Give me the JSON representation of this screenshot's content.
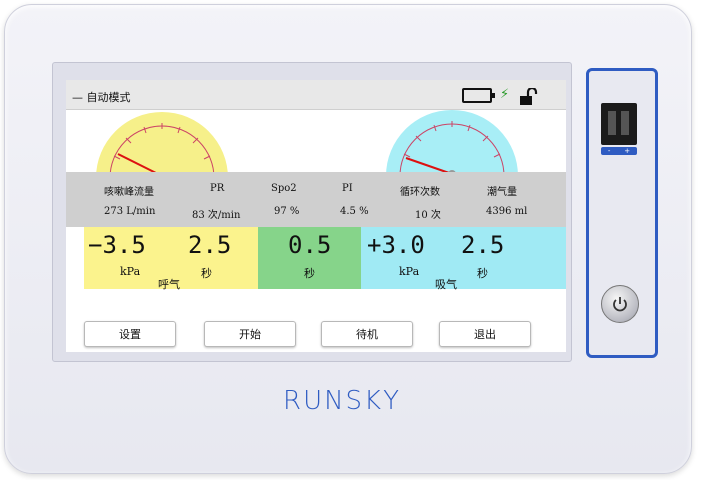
{
  "status_bar": {
    "mode_title": "— 自动模式",
    "icons": [
      "battery-icon",
      "plug-icon",
      "unlock-icon"
    ]
  },
  "parameters": [
    {
      "name": "咳嗽峰流量",
      "value": "273 L/min"
    },
    {
      "name": "PR",
      "value": "83 次/min"
    },
    {
      "name": "Spo2",
      "value": "97 %"
    },
    {
      "name": "PI",
      "value": "4.5 %"
    },
    {
      "name": "循环次数",
      "value": "10 次"
    },
    {
      "name": "潮气量",
      "value": "4396 ml"
    }
  ],
  "readouts": {
    "exhale": {
      "pressure": "−3.5",
      "pressure_unit": "kPa",
      "time": "2.5",
      "time_unit": "秒",
      "phase": "呼气"
    },
    "pause": {
      "time": "0.5",
      "time_unit": "秒"
    },
    "inhale": {
      "pressure": "+3.0",
      "pressure_unit": "kPa",
      "time": "2.5",
      "time_unit": "秒",
      "phase": "吸气"
    }
  },
  "buttons": [
    {
      "label": "设置"
    },
    {
      "label": "开始"
    },
    {
      "label": "待机"
    },
    {
      "label": "退出"
    }
  ],
  "hardware": {
    "usb_minus": "-",
    "usb_plus": "+"
  },
  "brand": "RUNSKY",
  "colors": {
    "exhale": "#fbf38d",
    "pause": "#86d48a",
    "inhale": "#a0eaf4",
    "accent": "#2f5cc2"
  }
}
